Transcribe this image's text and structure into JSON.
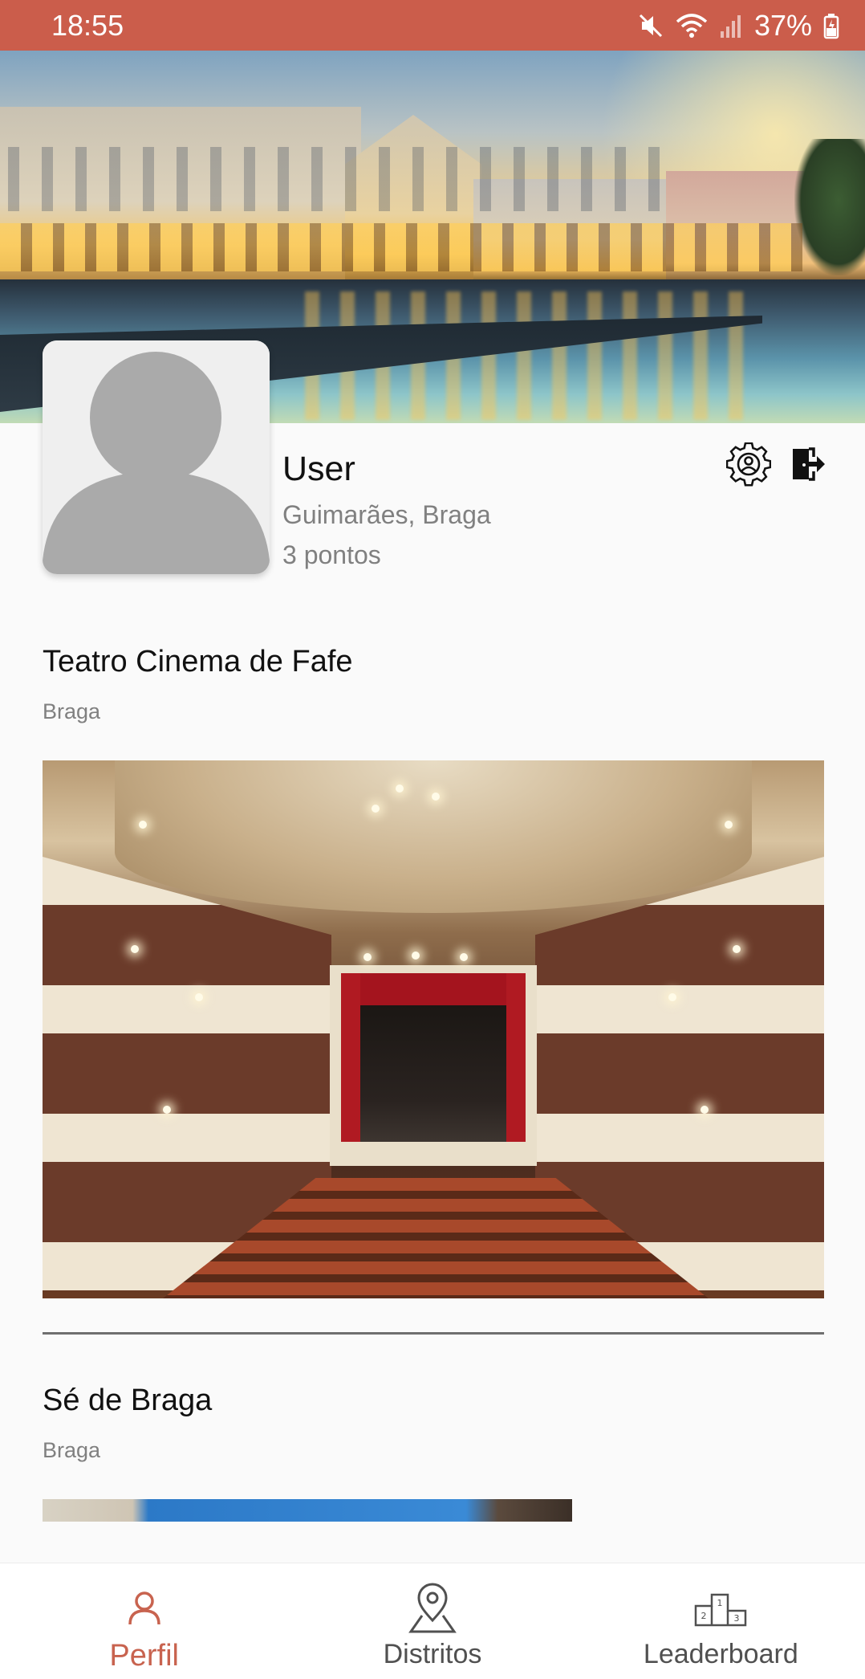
{
  "status_bar": {
    "time": "18:55",
    "battery": "37%",
    "icons": [
      "mute-icon",
      "wifi-icon",
      "signal-icon",
      "battery-icon"
    ]
  },
  "header": {
    "banner_image": "city-square-banner"
  },
  "profile": {
    "name": "User",
    "location": "Guimarães, Braga",
    "points": "3 pontos",
    "avatar": "default-avatar-placeholder",
    "settings_icon": "gear-icon",
    "logout_icon": "logout-icon"
  },
  "feed": {
    "places": [
      {
        "name": "Teatro Cinema de Fafe",
        "district": "Braga",
        "photo": "theatre-interior-photo"
      },
      {
        "name": "Sé de Braga",
        "district": "Braga",
        "photo": "cathedral-photo"
      }
    ]
  },
  "bottom_nav": {
    "items": [
      {
        "label": "Perfil",
        "icon": "person-icon",
        "active": true
      },
      {
        "label": "Distritos",
        "icon": "map-pin-icon",
        "active": false
      },
      {
        "label": "Leaderboard",
        "icon": "podium-icon",
        "active": false
      }
    ]
  },
  "colors": {
    "accent": "#cb5d4b",
    "active_nav": "#c8634f",
    "background": "#fafafa",
    "muted_text": "#808080"
  }
}
